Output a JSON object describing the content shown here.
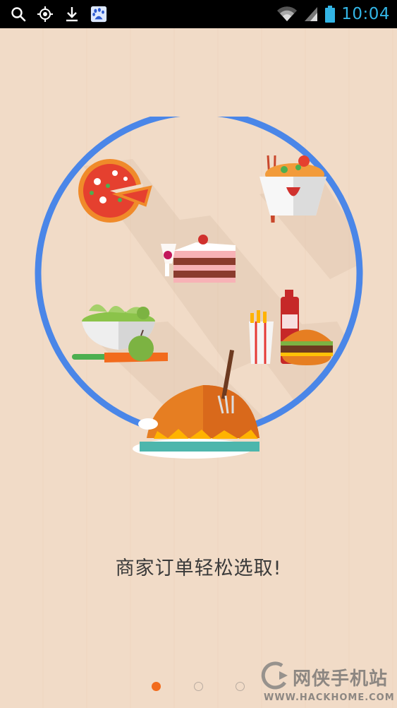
{
  "status_bar": {
    "time": "10:04",
    "icons": [
      "search-icon",
      "gps-icon",
      "download-icon",
      "baidu-paw-icon",
      "wifi-icon",
      "signal-icon",
      "battery-icon"
    ]
  },
  "onboarding": {
    "caption": "商家订单轻松选取!",
    "page_count": 3,
    "current_page": 1,
    "ring_color": "#4a86e8",
    "accent_color": "#f26b1d",
    "food_icons": [
      "pizza-icon",
      "noodle-box-icon",
      "cake-icon",
      "salad-icon",
      "burger-fries-icon",
      "roast-chicken-icon"
    ]
  },
  "watermark": {
    "name": "网侠手机站",
    "url": "WWW.HACKHOME.COM"
  }
}
